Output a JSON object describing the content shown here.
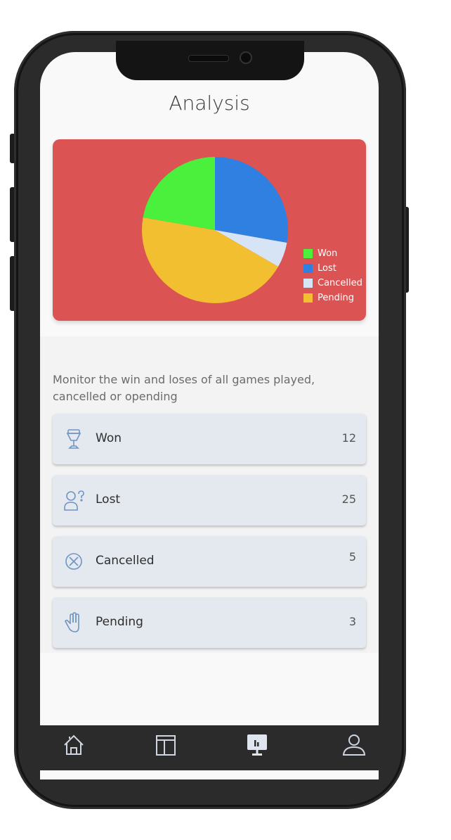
{
  "header": {
    "title": "Analysis"
  },
  "chart_data": {
    "type": "pie",
    "slices": [
      {
        "label": "Lost",
        "value": 25,
        "color": "#2f80e0"
      },
      {
        "label": "Cancelled",
        "value": 5,
        "color": "#d6e4f6"
      },
      {
        "label": "Pending",
        "value": 40,
        "color": "#f2bf30"
      },
      {
        "label": "Won",
        "value": 20,
        "color": "#4af03c"
      }
    ],
    "legend": [
      "Won",
      "Lost",
      "Cancelled",
      "Pending"
    ],
    "legend_colors": [
      "#4af03c",
      "#2f80e0",
      "#d6e4f6",
      "#f2bf30"
    ],
    "legend_position": "bottom-right",
    "background": "#dc5353"
  },
  "description": "Monitor the win and loses of all games played, cancelled or opending",
  "stats": [
    {
      "label": "Won",
      "value": "12",
      "icon": "trophy-icon"
    },
    {
      "label": "Lost",
      "value": "25",
      "icon": "user-question-icon"
    },
    {
      "label": "Cancelled",
      "value": "5",
      "icon": "cancel-circle-icon"
    },
    {
      "label": "Pending",
      "value": "3",
      "icon": "hand-icon"
    }
  ],
  "tabbar": {
    "items": [
      {
        "icon": "home-icon",
        "active": false
      },
      {
        "icon": "calendar-panel-icon",
        "active": false
      },
      {
        "icon": "analytics-monitor-icon",
        "active": true
      },
      {
        "icon": "profile-icon",
        "active": false
      }
    ]
  }
}
